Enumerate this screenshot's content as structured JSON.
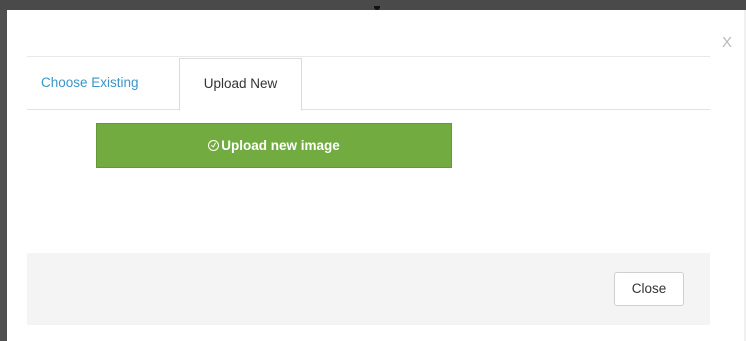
{
  "modal": {
    "close_glyph": "X",
    "tabs": [
      {
        "label": "Choose Existing",
        "active": false
      },
      {
        "label": "Upload New",
        "active": true
      }
    ],
    "upload_button": {
      "label": "Upload new image",
      "icon": "circle-arrow-icon",
      "color": "#72ab3f"
    },
    "footer": {
      "close_label": "Close"
    }
  },
  "colors": {
    "link": "#3b96c8",
    "accent_green": "#72ab3f",
    "footer_bg": "#f4f4f4"
  }
}
